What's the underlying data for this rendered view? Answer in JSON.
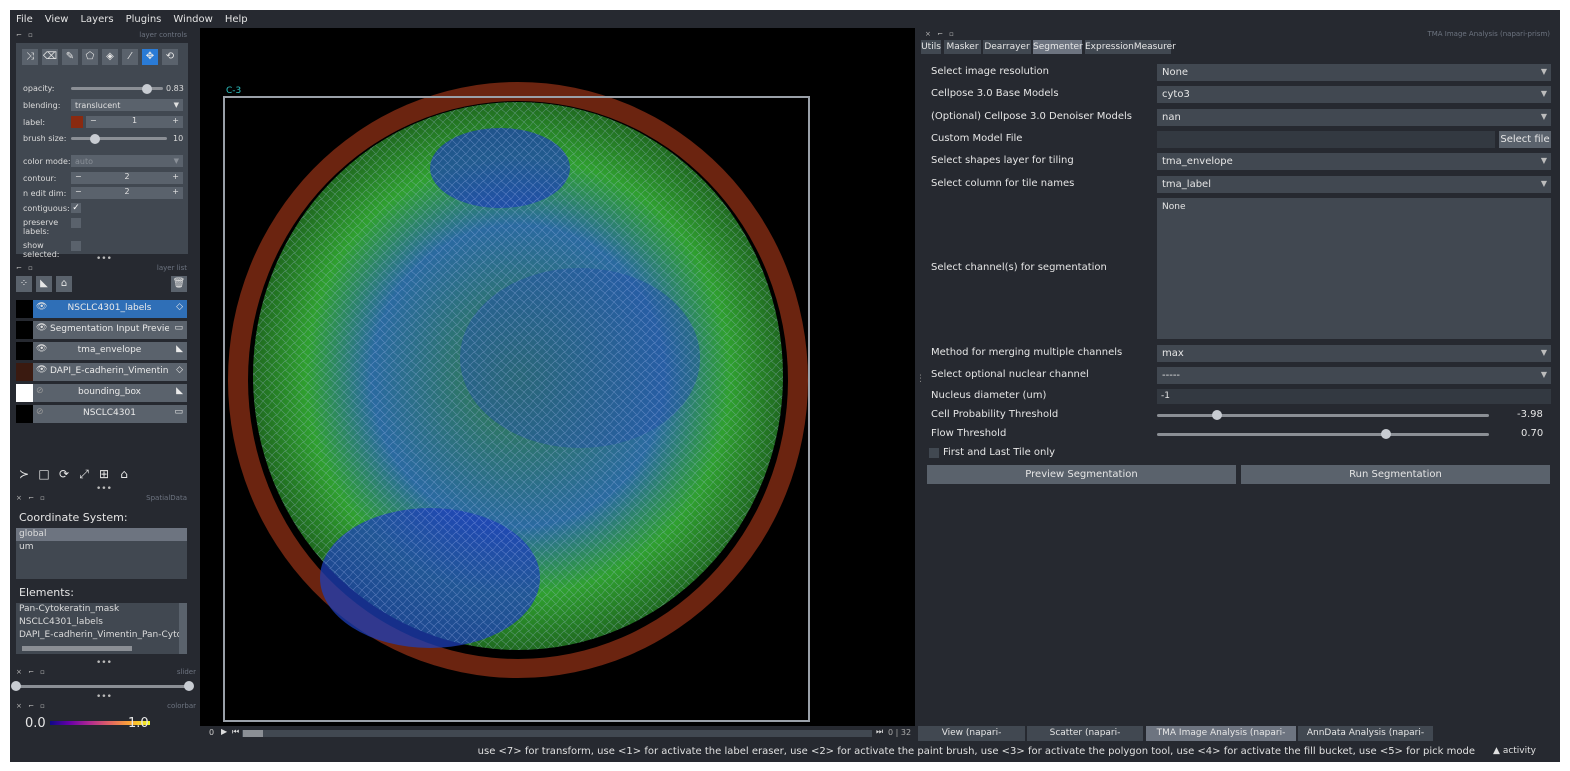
{
  "menu": [
    "File",
    "View",
    "Layers",
    "Plugins",
    "Window",
    "Help"
  ],
  "layer_controls": {
    "title": "layer controls",
    "opacity_label": "opacity:",
    "opacity_value": "0.83",
    "opacity_fraction": 0.83,
    "blending_label": "blending:",
    "blending_value": "translucent",
    "label_label": "label:",
    "label_value": "1",
    "brush_size_label": "brush size:",
    "brush_size_value": "10",
    "color_mode_label": "color mode:",
    "color_mode_value": "auto",
    "contour_label": "contour:",
    "contour_value": "2",
    "n_edit_dim_label": "n edit dim:",
    "n_edit_dim_value": "2",
    "contiguous_label": "contiguous:",
    "preserve_label_1": "preserve",
    "preserve_label_2": "labels:",
    "show_label_1": "show",
    "show_label_2": "selected:",
    "label_color": "#8a2a10"
  },
  "layer_list": {
    "title": "layer list",
    "layers": [
      {
        "name": "NSCLC4301_labels"
      },
      {
        "name": "Segmentation Input Preview"
      },
      {
        "name": "tma_envelope"
      },
      {
        "name": "DAPI_E-cadherin_Vimentin..."
      },
      {
        "name": "bounding_box"
      },
      {
        "name": "NSCLC4301"
      }
    ]
  },
  "spatialdata": {
    "title": "SpatialData",
    "coord_label": "Coordinate System:",
    "coords": [
      "global",
      "um"
    ],
    "elements_label": "Elements:",
    "elements": [
      "Pan-Cytokeratin_mask",
      "NSCLC4301_labels",
      "DAPI_E-cadherin_Vimentin_Pan-Cytoke"
    ]
  },
  "slider_title": "slider",
  "colorbar": {
    "title": "colorbar",
    "min": "0.0",
    "max": "1.0"
  },
  "canvas": {
    "overlay_label": "C-3",
    "frame_current": "0",
    "frame_total": "32"
  },
  "right_panel": {
    "title": "TMA Image Analysis (napari-prism)",
    "tabs": [
      "Utils",
      "Masker",
      "Dearrayer",
      "Segmenter",
      "ExpressionMeasurer"
    ],
    "fields": {
      "resolution_label": "Select image resolution",
      "resolution_value": "None",
      "base_models_label": "Cellpose 3.0 Base Models",
      "base_models_value": "cyto3",
      "denoiser_label": "(Optional) Cellpose 3.0 Denoiser Models",
      "denoiser_value": "nan",
      "custom_model_label": "Custom Model File",
      "select_file": "Select file",
      "shapes_label": "Select shapes layer for tiling",
      "shapes_value": "tma_envelope",
      "column_label": "Select column for tile names",
      "column_value": "tma_label",
      "channels_label": "Select channel(s) for segmentation",
      "channels_value": "None",
      "merge_label": "Method for merging multiple channels",
      "merge_value": "max",
      "nuclear_label": "Select optional nuclear channel",
      "nuclear_value": "-----",
      "diameter_label": "Nucleus diameter (um)",
      "diameter_value": "-1",
      "cellprob_label": "Cell Probability Threshold",
      "cellprob_value": "-3.98",
      "cellprob_fraction": 0.18,
      "flow_label": "Flow Threshold",
      "flow_value": "0.70",
      "flow_fraction": 0.69,
      "first_last_label": "First and Last Tile only",
      "preview_btn": "Preview Segmentation",
      "run_btn": "Run Segmentation"
    }
  },
  "bottom_tabs": [
    "View (napari-spatialdata)",
    "Scatter (napari-spatialdata)",
    "TMA Image Analysis (napari-prism)",
    "AnnData Analysis (napari-prism)"
  ],
  "status": {
    "hint": "use <7> for transform, use <1> for activate the label eraser, use <2> for activate the paint brush, use <3> for activate the polygon tool, use <4> for activate the fill bucket, use <5> for pick mode",
    "activity": "activity"
  },
  "colors": {
    "window": "#262930",
    "panel": "#414851",
    "control": "#5a626c",
    "accent": "#2a7bd6",
    "envelope": "#6b2410"
  }
}
